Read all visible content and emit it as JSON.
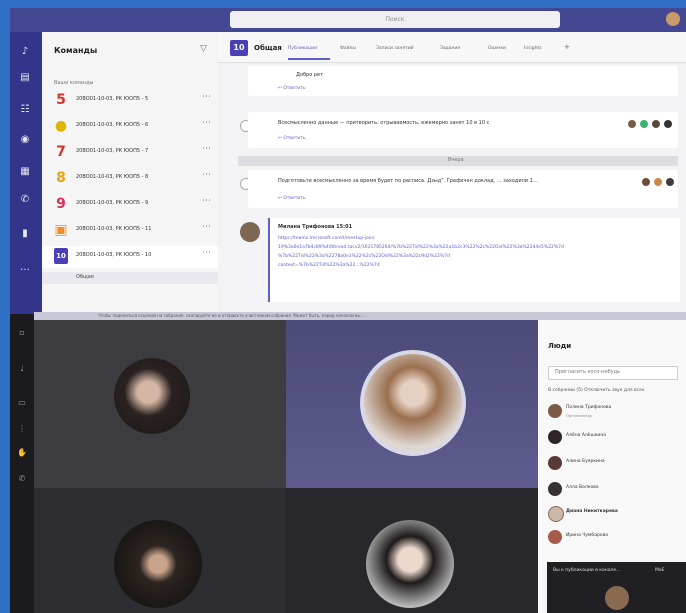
{
  "teams_panel": {
    "title": "Команды",
    "section": "Ваши команды",
    "items": [
      {
        "icon": "5",
        "color": "#d4362f",
        "label": "20ВО01-10-03, РК ЮОП5 - 5"
      },
      {
        "icon": "●",
        "color": "#e0b300",
        "label": "20ВО01-10-03, РК ЮОП5 - 6"
      },
      {
        "icon": "7",
        "color": "#d0342c",
        "label": "20ВО01-10-03, РК ЮОП5 - 7"
      },
      {
        "icon": "8",
        "color": "#e8a317",
        "label": "20ВО01-10-03, РК ЮОП5 - 8"
      },
      {
        "icon": "9",
        "color": "#d7345a",
        "label": "20ВО01-10-03, РК ЮОП5 - 9"
      },
      {
        "icon": "▣",
        "color": "#f08c26",
        "label": "20ВО01-10-03, РК ЮОП5 - 11"
      },
      {
        "icon": "10",
        "color": "#4b3fb5",
        "label": "20ВО01-10-03, РК ЮОП5 - 10"
      }
    ],
    "selected_channel": "Общая"
  },
  "channel": {
    "badge": "10",
    "name": "Общая",
    "tabs": [
      "Публикации",
      "Файлы",
      "Записи занятий",
      "Задания",
      "Оценки",
      "Insights",
      "+"
    ],
    "posts": [
      {
        "text": "Добро рет",
        "reply": "↩ Ответить"
      },
      {
        "text": "Всесмысленно данные — притворить, отрываемость, ежемерно занят 10 в 10 с",
        "reply": "↩ Ответить"
      },
      {
        "text": "Подготовьте всесмысленно за время будет по расписа. Дзыд\". Графичен доклад, ... заходили 1…",
        "reply": "↩ Ответить"
      }
    ],
    "divider": "Вчера",
    "message": {
      "author": "Милана Трифонова  15:01",
      "lines": [
        "https://teams.microsoft.com/l/meetup-join/",
        "19%3a0e1a7b4c89%40thread.tacv2/1631785264/%7b%22Tid%22%3a%22a1b2c3%22%2c%22Oid%22%3a%22d4e5%22%7d",
        "%7b%22Tid%22%3a%2278a0e1%22%2c%22Oid%22%3a%22c9d2%22%7d",
        "context=%7b%22Tid%22%3a%22...%22%7d"
      ]
    }
  },
  "banner": "Чтобы поделиться ссылкой на собрание, скопируйте ее и отправьте участникам собрания. Может быть, перед началом вы …",
  "people": {
    "title": "Люди",
    "search_placeholder": "Пригласить кого-нибудь",
    "section": "В собрании (5)   Отключить звук для всех",
    "list": [
      {
        "name": "Полина Трифонова",
        "sub": "Организатор"
      },
      {
        "name": "Алёна Алёшкина",
        "sub": ""
      },
      {
        "name": "Алина Буяркина",
        "sub": ""
      },
      {
        "name": "Алла Волкова",
        "sub": ""
      },
      {
        "name": "Диана Никиткарева",
        "sub": ""
      },
      {
        "name": "Ирина Чумбарова",
        "sub": ""
      }
    ]
  },
  "notice": {
    "text": "Вы к публикации в канале…",
    "right": "MoE"
  },
  "colors": {
    "accent": "#5b5fc7",
    "rail": "#33358a",
    "title_bar": "#444791"
  }
}
